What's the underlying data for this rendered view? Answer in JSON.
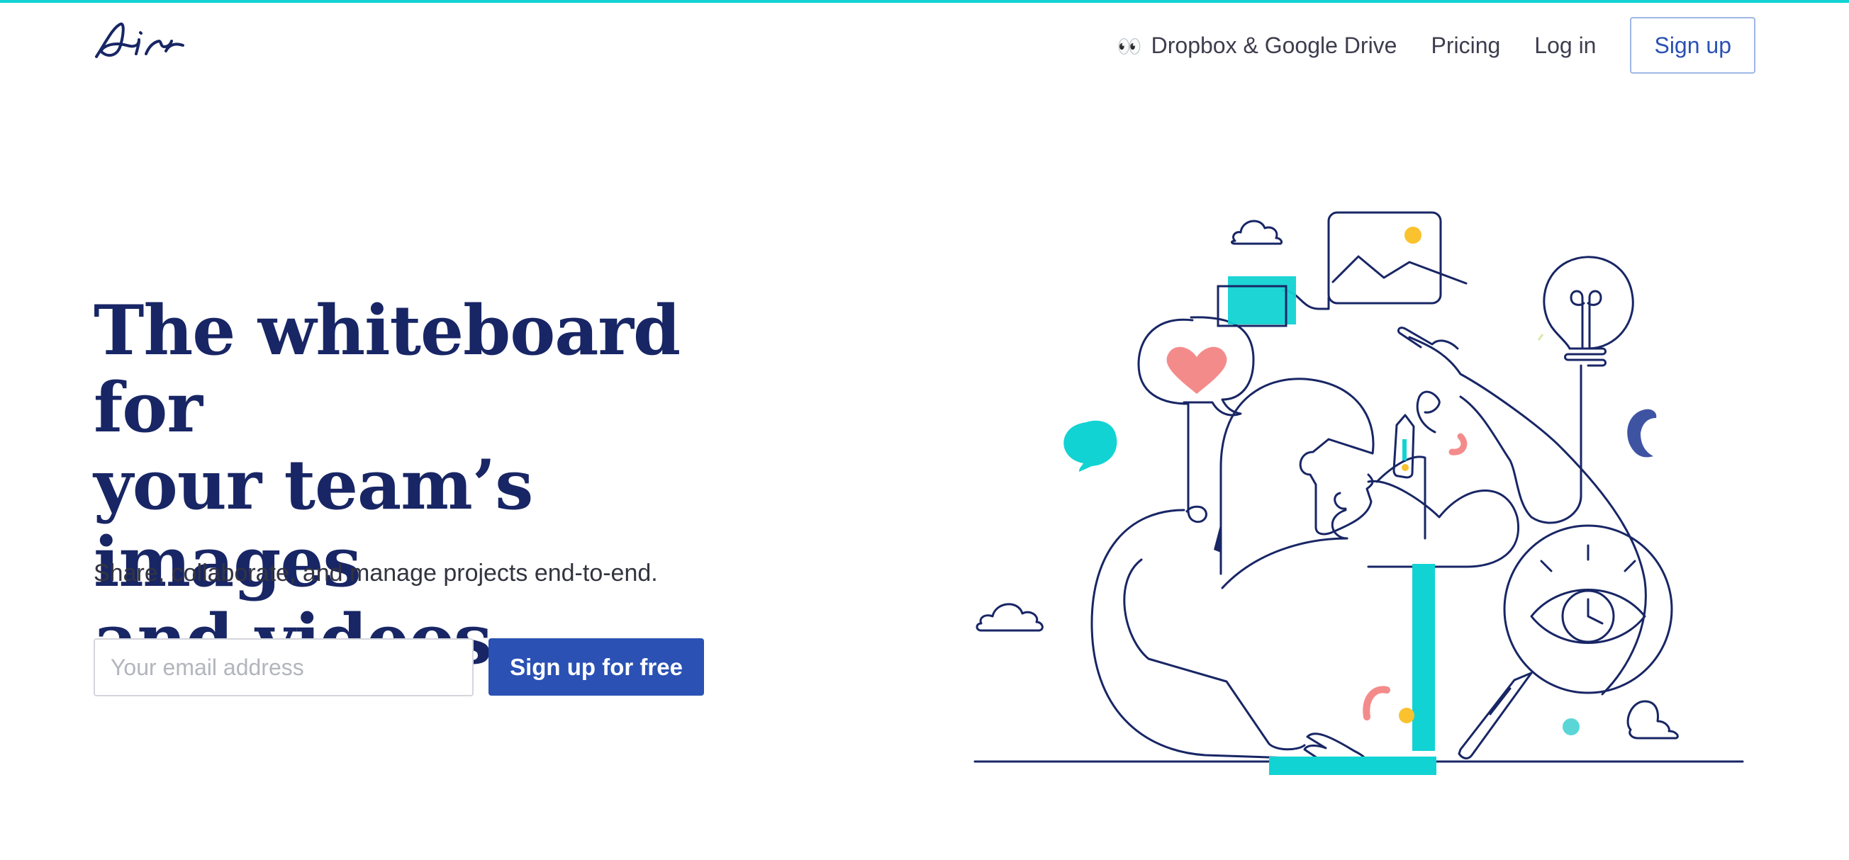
{
  "header": {
    "logo_text": "Air",
    "nav": {
      "eyes_emoji": "👀",
      "integrations_label": "Dropbox & Google Drive",
      "pricing_label": "Pricing",
      "login_label": "Log in",
      "signup_label": "Sign up"
    }
  },
  "hero": {
    "title_line1": "The whiteboard for",
    "title_line2": "your team’s images",
    "title_line3": "and videos",
    "subtitle": "Share, collaborate, and manage projects end-to-end.",
    "email_placeholder": "Your email address",
    "email_value": "",
    "cta_label": "Sign up for free"
  },
  "colors": {
    "accent_cyan": "#12d3d3",
    "brand_blue": "#2a51b3",
    "navy": "#182665",
    "coral": "#f48b8b",
    "yellow": "#f9c22e"
  },
  "illustration_icons": [
    "cloud-icon",
    "image-frame-icon",
    "heart-bubble-icon",
    "chat-bubble-icon",
    "lightbulb-icon",
    "eye-magnifier-icon",
    "person-with-laptop"
  ]
}
